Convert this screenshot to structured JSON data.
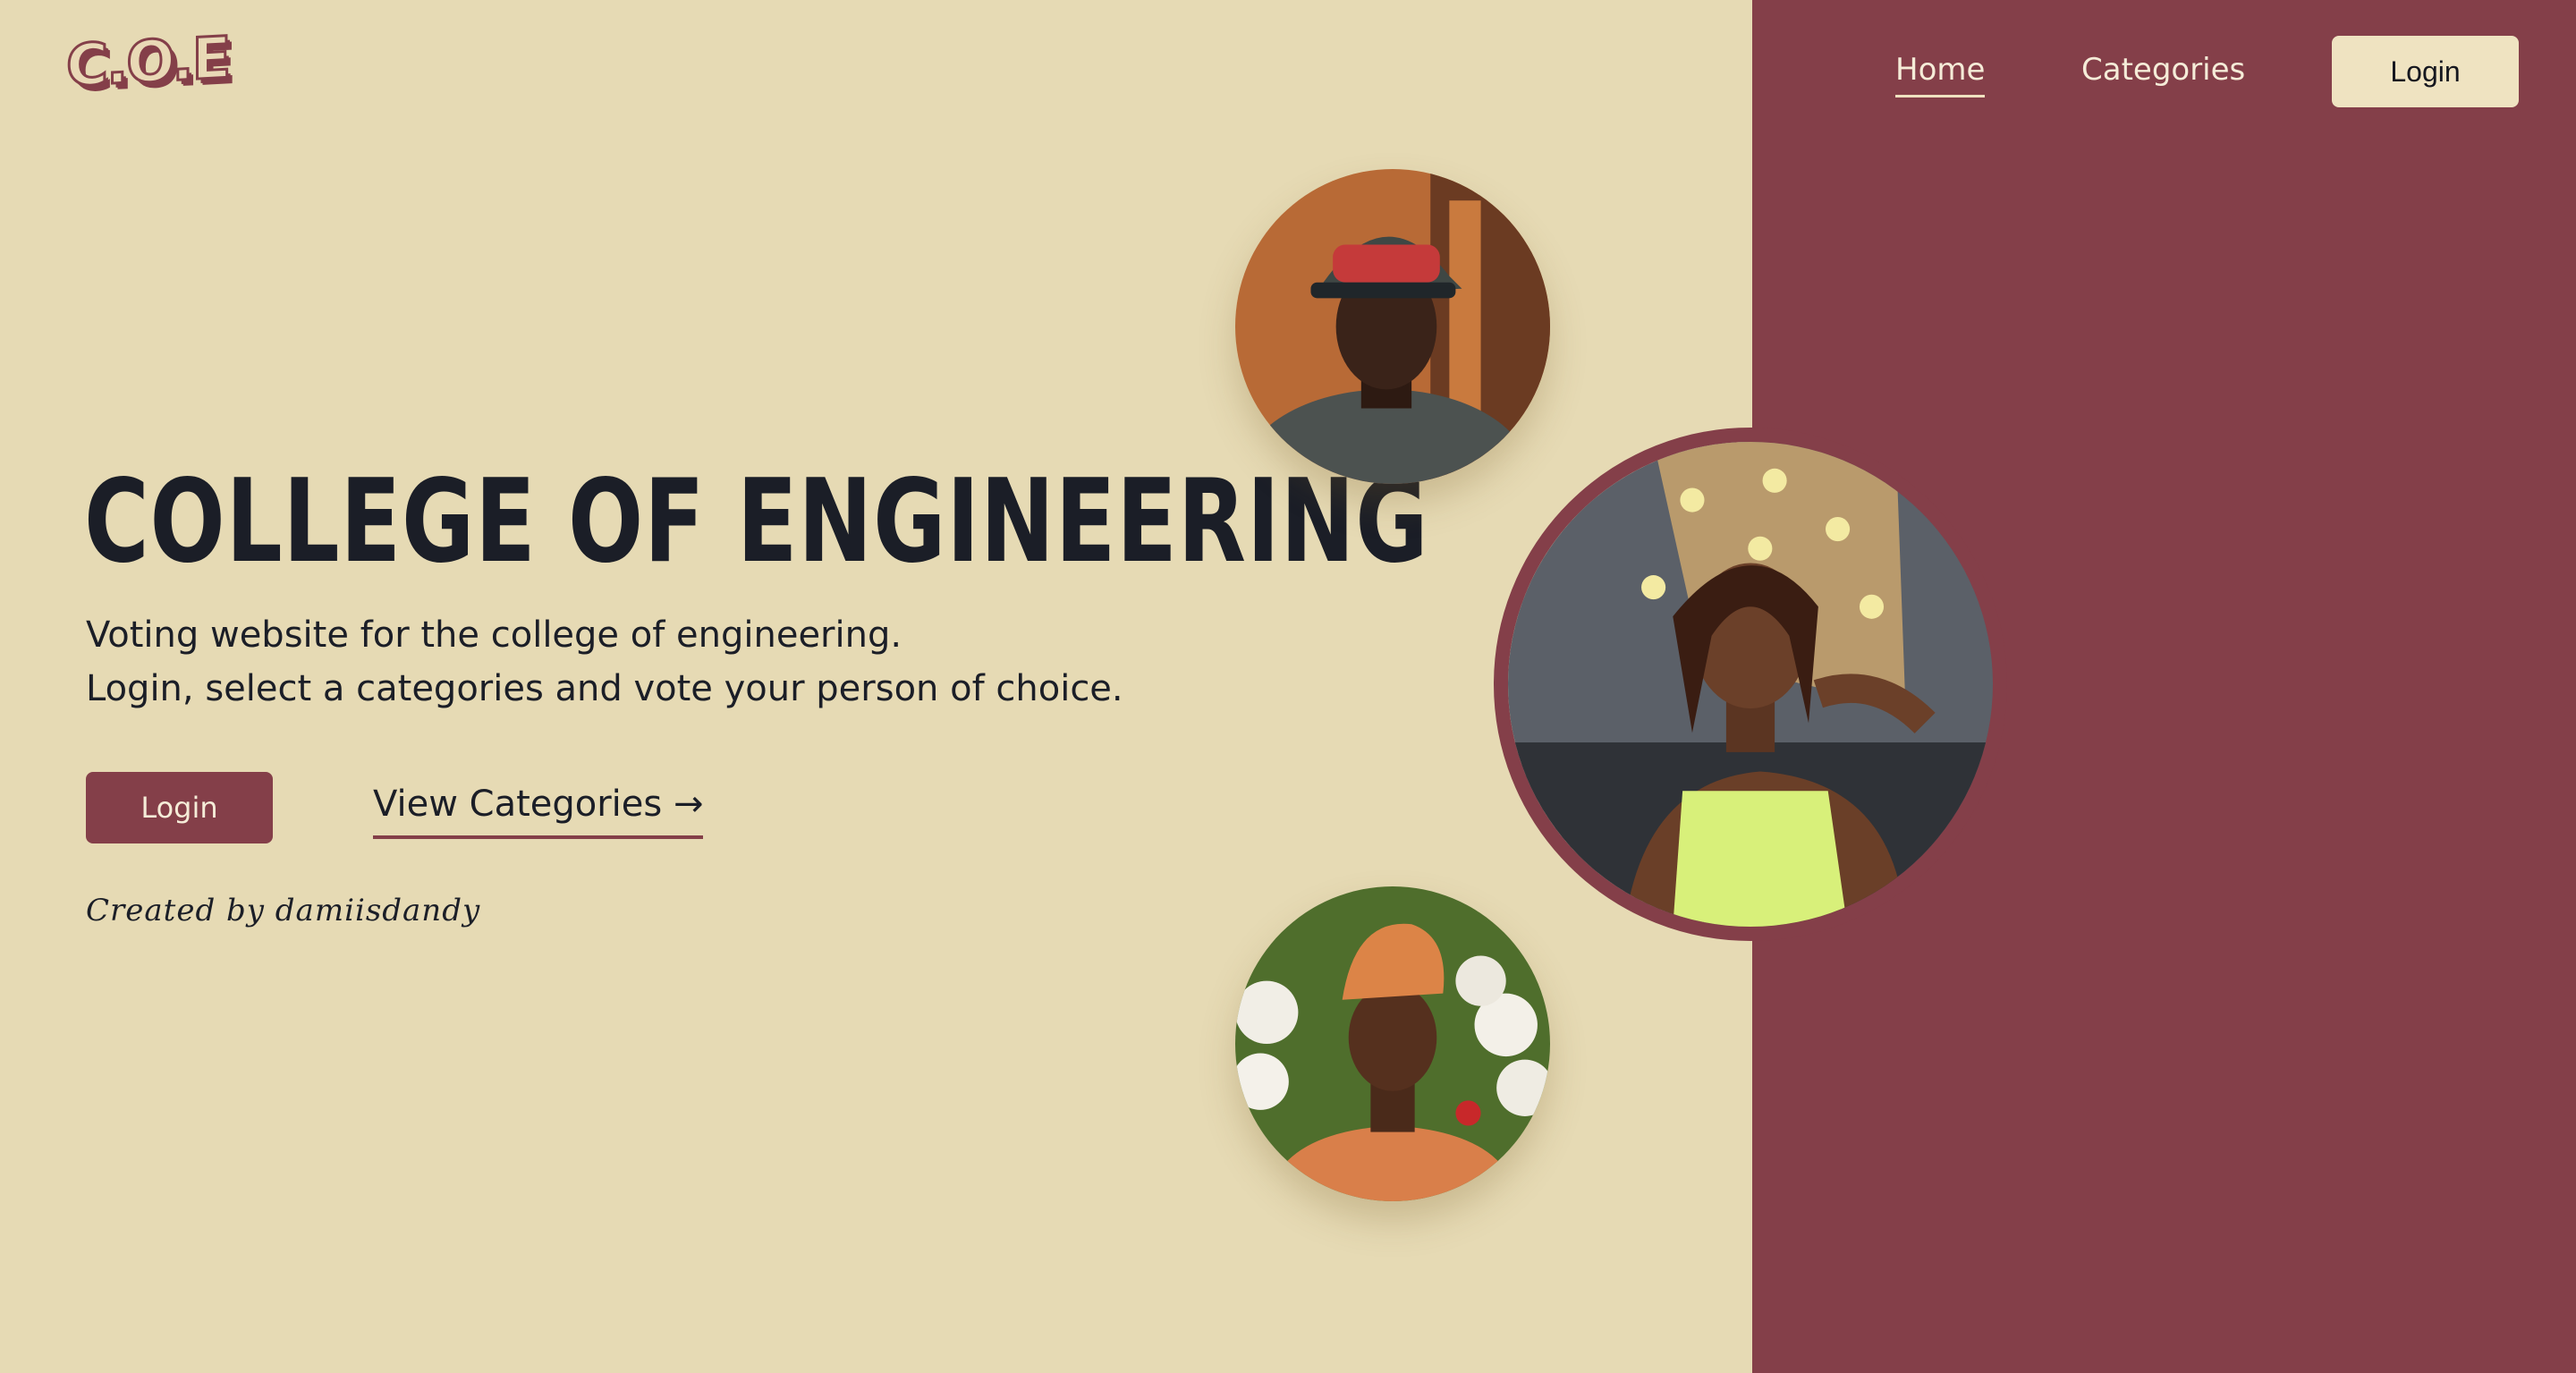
{
  "brand": {
    "logo_text": "C.O.E"
  },
  "nav": {
    "home_label": "Home",
    "categories_label": "Categories",
    "login_label": "Login"
  },
  "hero": {
    "title": "COLLEGE OF ENGINEERING",
    "subtitle_line1": "Voting website for the college of engineering.",
    "subtitle_line2": "Login, select a categories and vote your person of choice.",
    "login_button": "Login",
    "view_categories_button": "View Categories →",
    "credit": "Created by damiisdandy"
  },
  "colors": {
    "background": "#e6dab4",
    "accent": "#843f49",
    "text": "#1b1e27",
    "button_light": "#efe3c1"
  }
}
